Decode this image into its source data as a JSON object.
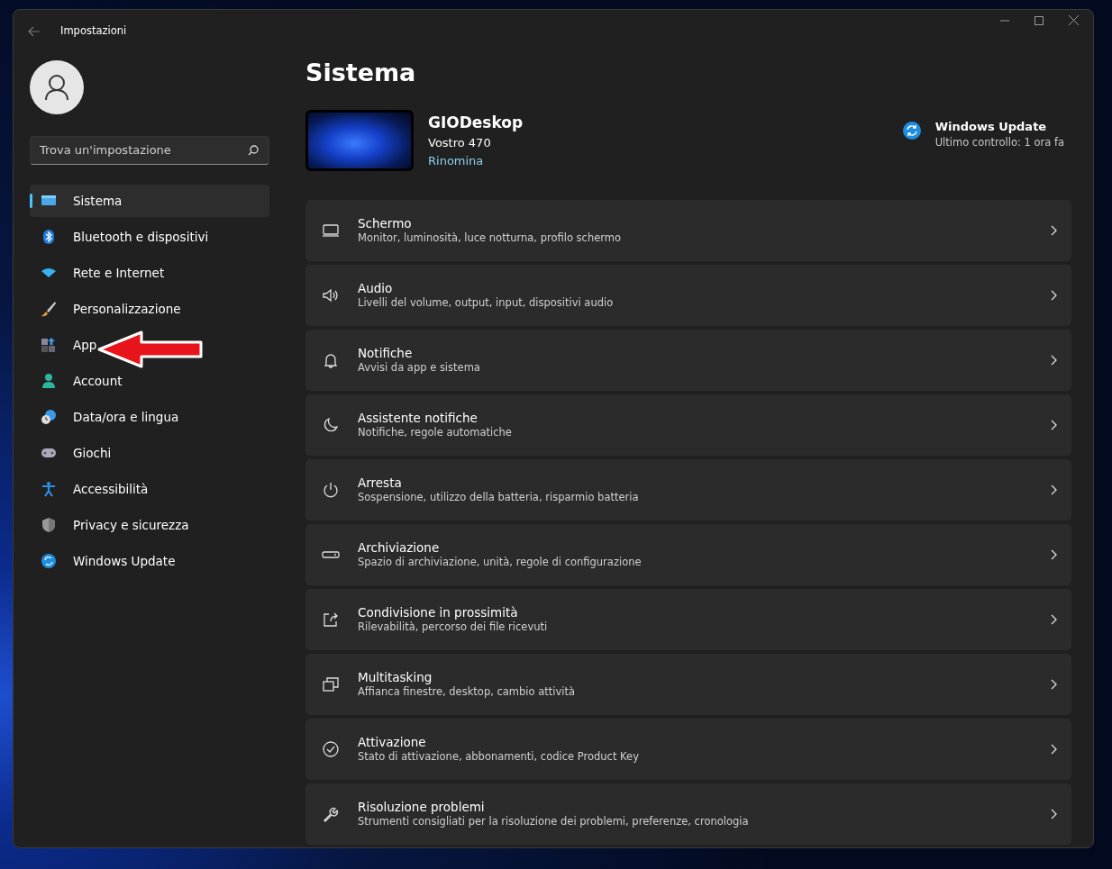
{
  "window": {
    "title": "Impostazioni"
  },
  "search": {
    "placeholder": "Trova un'impostazione"
  },
  "sidebar": {
    "items": [
      {
        "label": "Sistema",
        "selected": true
      },
      {
        "label": "Bluetooth e dispositivi",
        "selected": false
      },
      {
        "label": "Rete e Internet",
        "selected": false
      },
      {
        "label": "Personalizzazione",
        "selected": false
      },
      {
        "label": "App",
        "selected": false
      },
      {
        "label": "Account",
        "selected": false
      },
      {
        "label": "Data/ora e lingua",
        "selected": false
      },
      {
        "label": "Giochi",
        "selected": false
      },
      {
        "label": "Accessibilità",
        "selected": false
      },
      {
        "label": "Privacy e sicurezza",
        "selected": false
      },
      {
        "label": "Windows Update",
        "selected": false
      }
    ]
  },
  "page": {
    "title": "Sistema"
  },
  "device": {
    "name": "GIODeskop",
    "model": "Vostro 470",
    "rename": "Rinomina"
  },
  "update": {
    "title": "Windows Update",
    "status": "Ultimo controllo: 1 ora fa"
  },
  "settings": [
    {
      "title": "Schermo",
      "subtitle": "Monitor, luminosità, luce notturna, profilo schermo"
    },
    {
      "title": "Audio",
      "subtitle": "Livelli del volume, output, input, dispositivi audio"
    },
    {
      "title": "Notifiche",
      "subtitle": "Avvisi da app e sistema"
    },
    {
      "title": "Assistente notifiche",
      "subtitle": "Notifiche, regole automatiche"
    },
    {
      "title": "Arresta",
      "subtitle": "Sospensione, utilizzo della batteria, risparmio batteria"
    },
    {
      "title": "Archiviazione",
      "subtitle": "Spazio di archiviazione, unità, regole di configurazione"
    },
    {
      "title": "Condivisione in prossimità",
      "subtitle": "Rilevabilità, percorso dei file ricevuti"
    },
    {
      "title": "Multitasking",
      "subtitle": "Affianca finestre, desktop, cambio attività"
    },
    {
      "title": "Attivazione",
      "subtitle": "Stato di attivazione, abbonamenti, codice Product Key"
    },
    {
      "title": "Risoluzione problemi",
      "subtitle": "Strumenti consigliati per la risoluzione dei problemi, preferenze, cronologia"
    }
  ]
}
